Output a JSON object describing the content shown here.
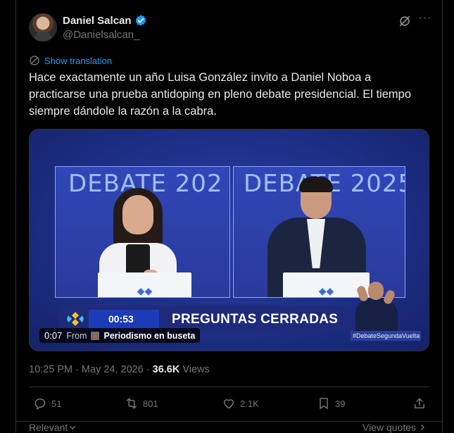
{
  "author": {
    "display_name": "Daniel Salcan",
    "handle": "@Danielsalcan_",
    "verified": true,
    "verified_color": "#1d9bf0"
  },
  "translate": {
    "label": "Show translation",
    "icon": "translate-icon",
    "link_color": "#1d9bf0"
  },
  "tweet": {
    "text": "Hace exactamente un año Luisa González invito a Daniel Noboa a practicarse una prueba antidoping en pleno debate presidencial. El tiempo siempre dándole la razón a la cabra."
  },
  "media": {
    "debate_title_left": "DEBATE 202",
    "debate_title_right": "DEBATE 2025",
    "timer": "00:53",
    "segment_title": "PREGUNTAS CERRADAS",
    "hashtag": "#DebateSegundaVuelta",
    "video_time": "0:07",
    "from_label": "From",
    "source_name": "Periodismo en buseta"
  },
  "meta": {
    "time": "10:25 PM",
    "separator": "·",
    "date": "May 24, 2026",
    "separator2": "·",
    "views_count": "36.6K",
    "views_label": "Views"
  },
  "actions": {
    "replies": "51",
    "retweets": "801",
    "likes": "2.1K",
    "bookmarks": "39"
  },
  "footer": {
    "sort_label": "Relevant",
    "view_quotes": "View quotes"
  },
  "colors": {
    "background": "#000000",
    "text_primary": "#e7e9ea",
    "text_secondary": "#71767b",
    "border": "#2f3336",
    "accent": "#1d9bf0"
  }
}
